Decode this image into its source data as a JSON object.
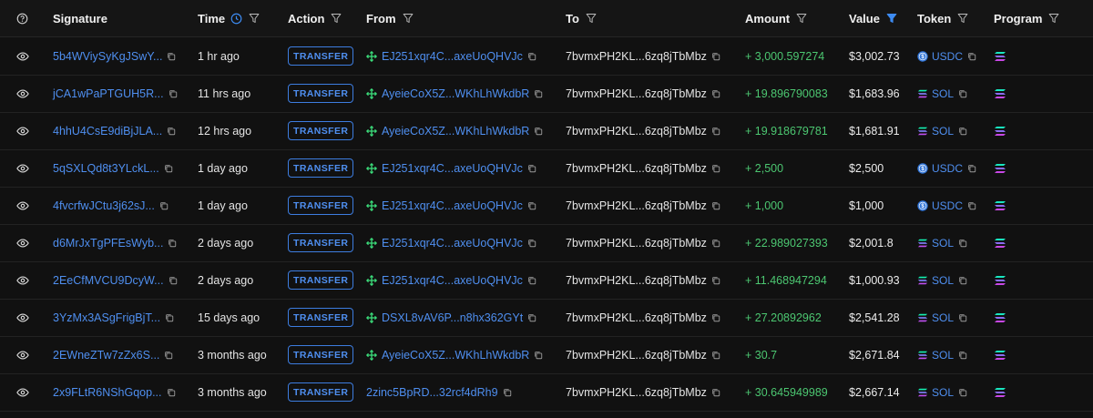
{
  "header": {
    "signature": "Signature",
    "time": "Time",
    "action": "Action",
    "from": "From",
    "to": "To",
    "amount": "Amount",
    "value": "Value",
    "token": "Token",
    "program": "Program"
  },
  "colors": {
    "link": "#4f8ff0",
    "positive_amount": "#4cc771",
    "background": "#111111",
    "active_filter": "#3d8bf2"
  },
  "rows": [
    {
      "signature": "5b4WViySyKgJSwY...",
      "time": "1 hr ago",
      "action": "TRANSFER",
      "from": "EJ251xqr4C...axeUoQHVJc",
      "from_icon": true,
      "to": "7bvmxPH2KL...6zq8jTbMbz",
      "amount": "+ 3,000.597274",
      "value": "$3,002.73",
      "token": "USDC",
      "token_icon": "usdc-icon"
    },
    {
      "signature": "jCA1wPaPTGUH5R...",
      "time": "11 hrs ago",
      "action": "TRANSFER",
      "from": "AyeieCoX5Z...WKhLhWkdbR",
      "from_icon": true,
      "to": "7bvmxPH2KL...6zq8jTbMbz",
      "amount": "+ 19.896790083",
      "value": "$1,683.96",
      "token": "SOL",
      "token_icon": "sol-icon"
    },
    {
      "signature": "4hhU4CsE9diBjJLA...",
      "time": "12 hrs ago",
      "action": "TRANSFER",
      "from": "AyeieCoX5Z...WKhLhWkdbR",
      "from_icon": true,
      "to": "7bvmxPH2KL...6zq8jTbMbz",
      "amount": "+ 19.918679781",
      "value": "$1,681.91",
      "token": "SOL",
      "token_icon": "sol-icon"
    },
    {
      "signature": "5qSXLQd8t3YLckL...",
      "time": "1 day ago",
      "action": "TRANSFER",
      "from": "EJ251xqr4C...axeUoQHVJc",
      "from_icon": true,
      "to": "7bvmxPH2KL...6zq8jTbMbz",
      "amount": "+ 2,500",
      "value": "$2,500",
      "token": "USDC",
      "token_icon": "usdc-icon"
    },
    {
      "signature": "4fvcrfwJCtu3j62sJ...",
      "time": "1 day ago",
      "action": "TRANSFER",
      "from": "EJ251xqr4C...axeUoQHVJc",
      "from_icon": true,
      "to": "7bvmxPH2KL...6zq8jTbMbz",
      "amount": "+ 1,000",
      "value": "$1,000",
      "token": "USDC",
      "token_icon": "usdc-icon"
    },
    {
      "signature": "d6MrJxTgPFEsWyb...",
      "time": "2 days ago",
      "action": "TRANSFER",
      "from": "EJ251xqr4C...axeUoQHVJc",
      "from_icon": true,
      "to": "7bvmxPH2KL...6zq8jTbMbz",
      "amount": "+ 22.989027393",
      "value": "$2,001.8",
      "token": "SOL",
      "token_icon": "sol-icon"
    },
    {
      "signature": "2EeCfMVCU9DcyW...",
      "time": "2 days ago",
      "action": "TRANSFER",
      "from": "EJ251xqr4C...axeUoQHVJc",
      "from_icon": true,
      "to": "7bvmxPH2KL...6zq8jTbMbz",
      "amount": "+ 11.468947294",
      "value": "$1,000.93",
      "token": "SOL",
      "token_icon": "sol-icon"
    },
    {
      "signature": "3YzMx3ASgFrigBjT...",
      "time": "15 days ago",
      "action": "TRANSFER",
      "from": "DSXL8vAV6P...n8hx362GYt",
      "from_icon": true,
      "to": "7bvmxPH2KL...6zq8jTbMbz",
      "amount": "+ 27.20892962",
      "value": "$2,541.28",
      "token": "SOL",
      "token_icon": "sol-icon"
    },
    {
      "signature": "2EWneZTw7zZx6S...",
      "time": "3 months ago",
      "action": "TRANSFER",
      "from": "AyeieCoX5Z...WKhLhWkdbR",
      "from_icon": true,
      "to": "7bvmxPH2KL...6zq8jTbMbz",
      "amount": "+ 30.7",
      "value": "$2,671.84",
      "token": "SOL",
      "token_icon": "sol-icon"
    },
    {
      "signature": "2x9FLtR6NShGqop...",
      "time": "3 months ago",
      "action": "TRANSFER",
      "from": "2zinc5BpRD...32rcf4dRh9",
      "from_icon": false,
      "to": "7bvmxPH2KL...6zq8jTbMbz",
      "amount": "+ 30.645949989",
      "value": "$2,667.14",
      "token": "SOL",
      "token_icon": "sol-icon"
    }
  ]
}
